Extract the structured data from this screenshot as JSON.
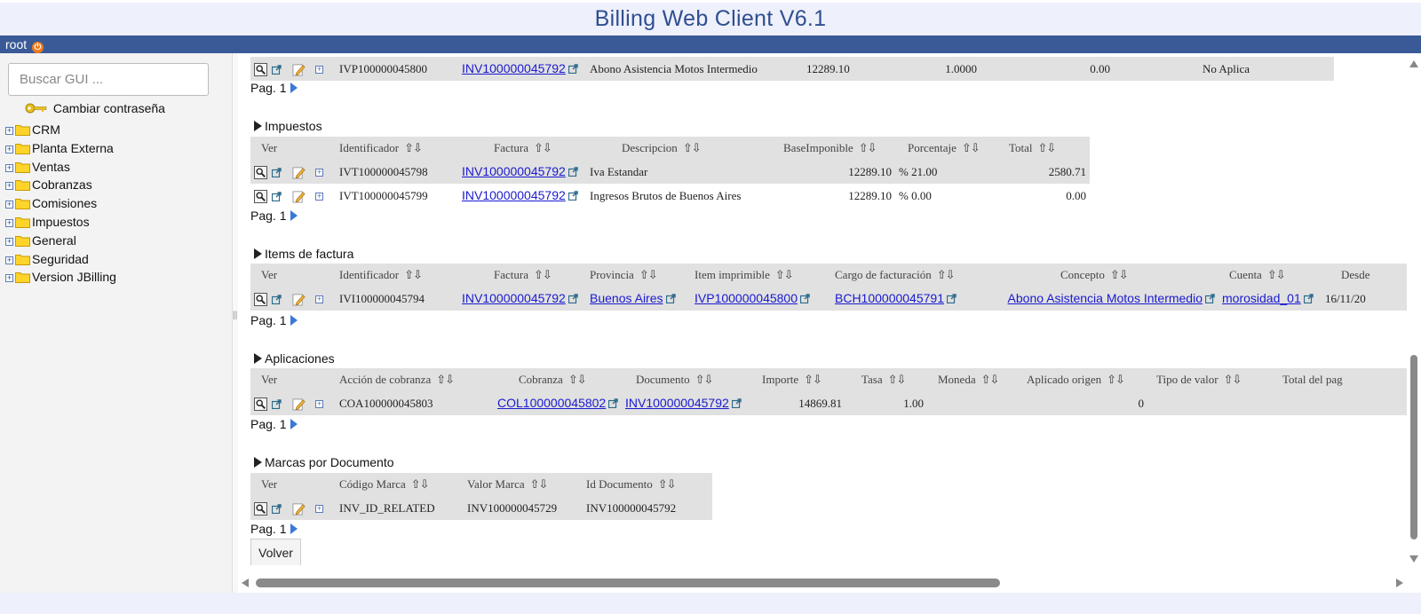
{
  "app": {
    "title": "Billing Web Client V6.1"
  },
  "user": {
    "name": "root"
  },
  "sidebar": {
    "search_placeholder": "Buscar GUI ...",
    "change_password": "Cambiar contraseña",
    "tree": [
      {
        "label": "CRM"
      },
      {
        "label": "Planta Externa"
      },
      {
        "label": "Ventas"
      },
      {
        "label": "Cobranzas"
      },
      {
        "label": "Comisiones"
      },
      {
        "label": "Impuestos"
      },
      {
        "label": "General"
      },
      {
        "label": "Seguridad"
      },
      {
        "label": "Version JBilling"
      }
    ]
  },
  "top_row": {
    "id": "IVP100000045800",
    "factura": "INV100000045792",
    "descripcion": "Abono Asistencia Motos Intermedio",
    "v1": "12289.10",
    "v2": "1.0000",
    "v3": "0.00",
    "v4": "No Aplica"
  },
  "pager": {
    "label": "Pag. 1"
  },
  "impuestos": {
    "title": "Impuestos",
    "headers": [
      "Ver",
      "Identificador",
      "Factura",
      "Descripcion",
      "BaseImponible",
      "Porcentaje",
      "Total"
    ],
    "rows": [
      {
        "id": "IVT100000045798",
        "factura": "INV100000045792",
        "descripcion": "Iva Estandar",
        "base": "12289.10",
        "porcentaje": "% 21.00",
        "total": "2580.71"
      },
      {
        "id": "IVT100000045799",
        "factura": "INV100000045792",
        "descripcion": "Ingresos Brutos de Buenos Aires",
        "base": "12289.10",
        "porcentaje": "% 0.00",
        "total": "0.00"
      }
    ]
  },
  "items": {
    "title": "Items de factura",
    "headers": [
      "Ver",
      "Identificador",
      "Factura",
      "Provincia",
      "Item imprimible",
      "Cargo de facturación",
      "Concepto",
      "Cuenta",
      "Desde"
    ],
    "rows": [
      {
        "id": "IVI100000045794",
        "factura": "INV100000045792",
        "provincia": "Buenos Aires",
        "item": "IVP100000045800",
        "cargo": "BCH100000045791",
        "concepto": "Abono Asistencia Motos Intermedio",
        "cuenta": "morosidad_01",
        "desde": "16/11/20"
      }
    ]
  },
  "aplicaciones": {
    "title": "Aplicaciones",
    "headers": [
      "Ver",
      "Acción de cobranza",
      "Cobranza",
      "Documento",
      "Importe",
      "Tasa",
      "Moneda",
      "Aplicado origen",
      "Tipo de valor",
      "Total del pag"
    ],
    "rows": [
      {
        "id": "COA100000045803",
        "cobranza": "COL100000045802",
        "documento": "INV100000045792",
        "importe": "14869.81",
        "tasa": "1.00",
        "moneda": "",
        "aplicado": "0",
        "tipo": "",
        "total": ""
      }
    ]
  },
  "marcas": {
    "title": "Marcas por Documento",
    "headers": [
      "Ver",
      "Código Marca",
      "Valor Marca",
      "Id Documento"
    ],
    "rows": [
      {
        "codigo": "INV_ID_RELATED",
        "valor": "INV100000045729",
        "documento": "INV100000045792"
      }
    ]
  },
  "buttons": {
    "volver": "Volver"
  },
  "colors": {
    "header_bar": "#3a5a97",
    "title": "#2f4f8f",
    "link": "#1a1ad0",
    "row_bg": "#e1e1e1"
  }
}
